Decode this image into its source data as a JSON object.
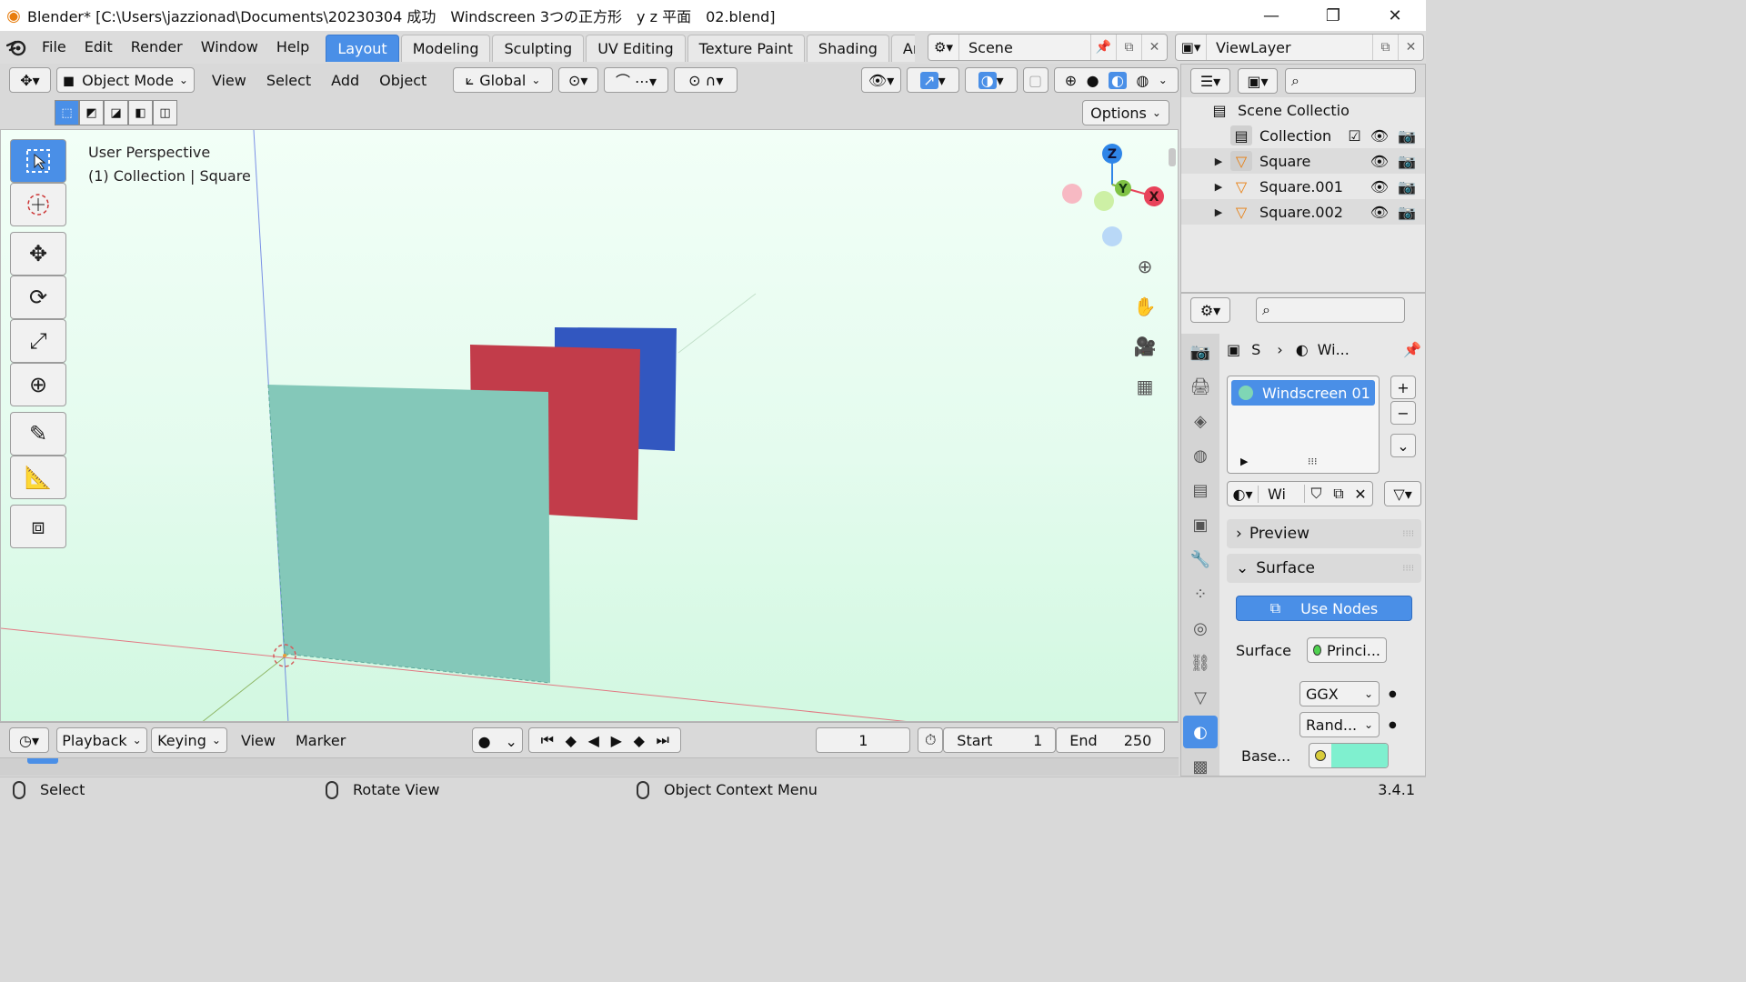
{
  "window": {
    "title": "Blender* [C:\\Users\\jazzionad\\Documents\\20230304 成功　Windscreen 3つの正方形　y z 平面　02.blend]",
    "minimize": "—",
    "maximize": "❐",
    "close": "✕"
  },
  "menu": {
    "items": [
      "File",
      "Edit",
      "Render",
      "Window",
      "Help"
    ]
  },
  "workspaces": {
    "tabs": [
      "Layout",
      "Modeling",
      "Sculpting",
      "UV Editing",
      "Texture Paint",
      "Shading",
      "Anim"
    ],
    "active": 0
  },
  "scene": {
    "name": "Scene"
  },
  "view_layer": {
    "name": "ViewLayer"
  },
  "viewport_header": {
    "mode": "Object Mode",
    "menus": [
      "View",
      "Select",
      "Add",
      "Object"
    ],
    "transform_orientation": "Global",
    "options": "Options"
  },
  "viewport": {
    "info_line1": "User Perspective",
    "info_line2": "(1) Collection | Square",
    "axis_labels": {
      "x": "X",
      "y": "Y",
      "z": "Z"
    },
    "background_top": "#f2fff7",
    "background_bottom": "#d2f8e1",
    "colors": {
      "square_teal": "#84c8b9",
      "square_red": "#c23c4a",
      "square_blue": "#3257c0",
      "axis_x": "#e8425a",
      "axis_y": "#7fc244",
      "axis_z": "#2f86e8"
    }
  },
  "timeline": {
    "menus": [
      "Playback",
      "Keying",
      "View",
      "Marker"
    ],
    "current_frame": "1",
    "start_label": "Start",
    "start_value": "1",
    "end_label": "End",
    "end_value": "250"
  },
  "statusbar": {
    "select": "Select",
    "rotate": "Rotate View",
    "context_menu": "Object Context Menu",
    "version": "3.4.1"
  },
  "outliner": {
    "root": "Scene Collectio",
    "collection": "Collection",
    "objects": [
      "Square",
      "Square.001",
      "Square.002"
    ]
  },
  "properties": {
    "breadcrumb_object": "S",
    "breadcrumb_material": "Wi...",
    "material_slot": "Windscreen 01",
    "material_name": "Wi",
    "panels": {
      "preview": "Preview",
      "surface": "Surface"
    },
    "use_nodes": "Use Nodes",
    "surface_label": "Surface",
    "surface_shader": "Princi...",
    "distribution": "GGX",
    "subsurface": "Rand...",
    "base_label": "Base...",
    "base_color": "#7ff0cf"
  }
}
